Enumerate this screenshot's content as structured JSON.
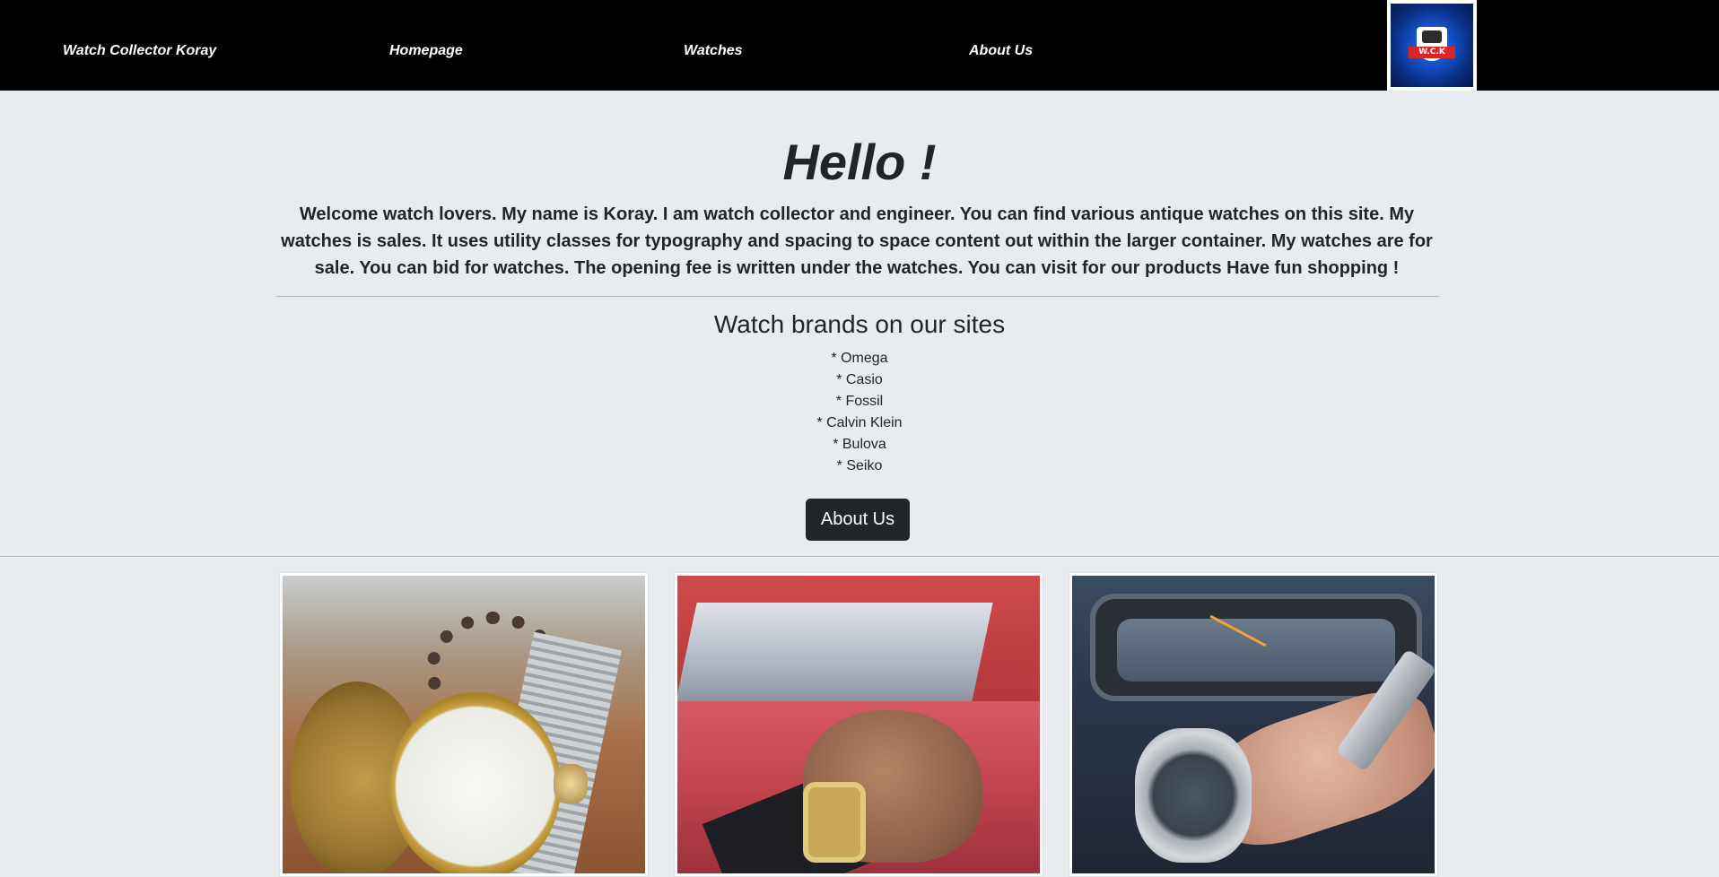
{
  "nav": {
    "brand": "Watch Collector Koray",
    "links": [
      "Homepage",
      "Watches",
      "About Us"
    ],
    "logo_text": "W.C.K"
  },
  "hero": {
    "title": "Hello !",
    "lead": "Welcome watch lovers. My name is Koray. I am watch collector and engineer. You can find various antique watches on this site. My watches is sales. It uses utility classes for typography and spacing to space content out within the larger container. My watches are for sale. You can bid for watches. The opening fee is written under the watches. You can visit for our products ",
    "lead_strong": "Have fun shopping !"
  },
  "brands": {
    "heading": "Watch brands on our sites",
    "items": [
      "* Omega",
      "* Casio",
      "* Fossil",
      "* Calvin Klein",
      "* Bulova",
      "* Seiko"
    ]
  },
  "about_button": "About Us",
  "colors": {
    "navbar": "#000000",
    "page_background": "#e9ecef",
    "button": "#212529",
    "text": "#212529"
  }
}
